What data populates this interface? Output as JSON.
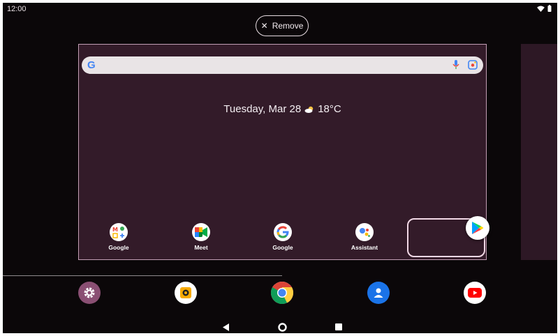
{
  "status_bar": {
    "time": "12:00",
    "icons": [
      "wifi-icon",
      "battery-icon"
    ]
  },
  "remove_button": {
    "label": "Remove",
    "icon": "close-icon"
  },
  "search_bar": {
    "logo": "G",
    "icons": [
      "google-logo-icon",
      "mic-icon",
      "lens-icon"
    ]
  },
  "glance": {
    "date": "Tuesday, Mar 28",
    "temperature": "18°C",
    "weather_icon": "partly-cloudy-icon"
  },
  "workspace_apps": [
    {
      "label": "Google",
      "icon": "google-apps-folder-icon"
    },
    {
      "label": "Meet",
      "icon": "meet-icon"
    },
    {
      "label": "Google",
      "icon": "google-icon"
    },
    {
      "label": "Assistant",
      "icon": "assistant-icon"
    }
  ],
  "dragged_app": {
    "icon": "play-store-icon"
  },
  "dock": [
    "settings-icon",
    "camera-icon",
    "chrome-icon",
    "contacts-icon",
    "youtube-icon"
  ],
  "nav_bar": [
    "back-icon",
    "home-icon",
    "recents-icon"
  ],
  "colors": {
    "background": "#0b0709",
    "workspace": "#331b29",
    "accent_border": "#c39fb5",
    "search_bg": "#e9e4e6"
  }
}
